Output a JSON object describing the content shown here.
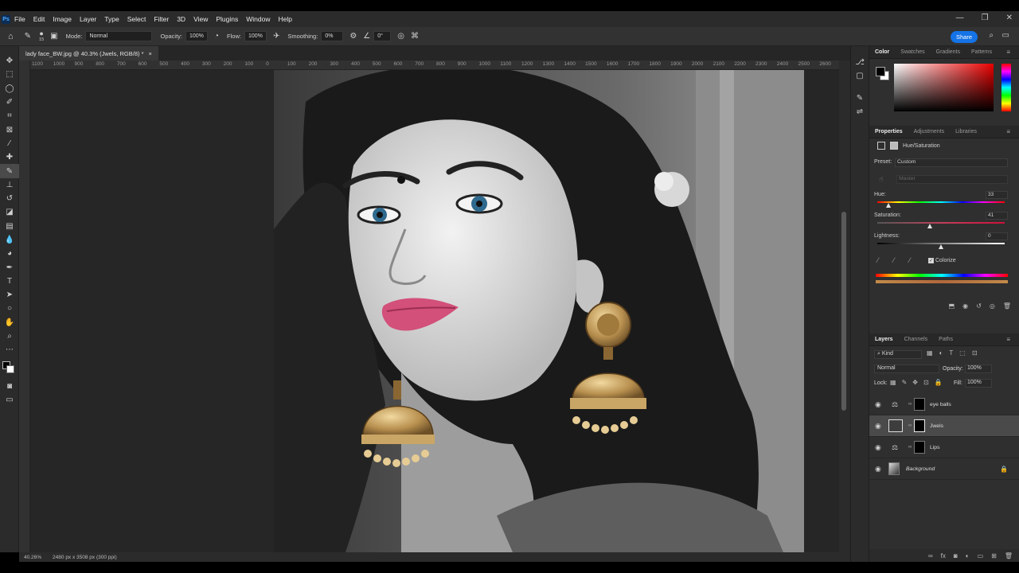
{
  "menubar": {
    "logo": "Ps",
    "items": [
      "File",
      "Edit",
      "Image",
      "Layer",
      "Type",
      "Select",
      "Filter",
      "3D",
      "View",
      "Plugins",
      "Window",
      "Help"
    ],
    "window_controls": [
      "—",
      "❐",
      "✕"
    ]
  },
  "options": {
    "brush_size": "15",
    "mode_label": "Mode:",
    "mode_value": "Normal",
    "opacity_label": "Opacity:",
    "opacity_value": "100%",
    "flow_label": "Flow:",
    "flow_value": "100%",
    "smoothing_label": "Smoothing:",
    "smoothing_value": "0%",
    "angle_value": "0°",
    "share_label": "Share"
  },
  "document": {
    "tab_title": "lady face_BW.jpg @ 40.3% (Jwels, RGB/8) *",
    "close_glyph": "×",
    "ruler_ticks": [
      "1100",
      "1000",
      "900",
      "800",
      "700",
      "600",
      "500",
      "400",
      "300",
      "200",
      "100",
      "0",
      "100",
      "200",
      "300",
      "400",
      "500",
      "600",
      "700",
      "800",
      "900",
      "1000",
      "1100",
      "1200",
      "1300",
      "1400",
      "1500",
      "1600",
      "1700",
      "1800",
      "1900",
      "2000",
      "2100",
      "2200",
      "2300",
      "2400",
      "2500",
      "2600"
    ],
    "status_zoom": "40.26%",
    "status_info": "2480 px x 3508 px (300 ppi)"
  },
  "color_panel": {
    "tabs": [
      "Color",
      "Swatches",
      "Gradients",
      "Patterns"
    ],
    "active_tab": "Color"
  },
  "properties": {
    "tabs": [
      "Properties",
      "Adjustments",
      "Libraries"
    ],
    "active_tab": "Properties",
    "title": "Hue/Saturation",
    "preset_label": "Preset:",
    "preset_value": "Custom",
    "channel_value": "Master",
    "hue_label": "Hue:",
    "hue_value": "33",
    "saturation_label": "Saturation:",
    "saturation_value": "41",
    "lightness_label": "Lightness:",
    "lightness_value": "0",
    "colorize_label": "Colorize",
    "colorize_checked": true,
    "hue_level": 0.09,
    "saturation_level": 0.41,
    "lightness_level": 0.5
  },
  "layers": {
    "tabs": [
      "Layers",
      "Channels",
      "Paths"
    ],
    "active_tab": "Layers",
    "filter_label": "Kind",
    "blend_mode": "Normal",
    "opacity_label": "Opacity:",
    "opacity_value": "100%",
    "lock_label": "Lock:",
    "fill_label": "Fill:",
    "fill_value": "100%",
    "items": [
      {
        "name": "eye balls",
        "selected": false
      },
      {
        "name": "Jwels",
        "selected": true
      },
      {
        "name": "Lips",
        "selected": false
      },
      {
        "name": "Background",
        "selected": false
      }
    ]
  },
  "accent": "#1473e6"
}
